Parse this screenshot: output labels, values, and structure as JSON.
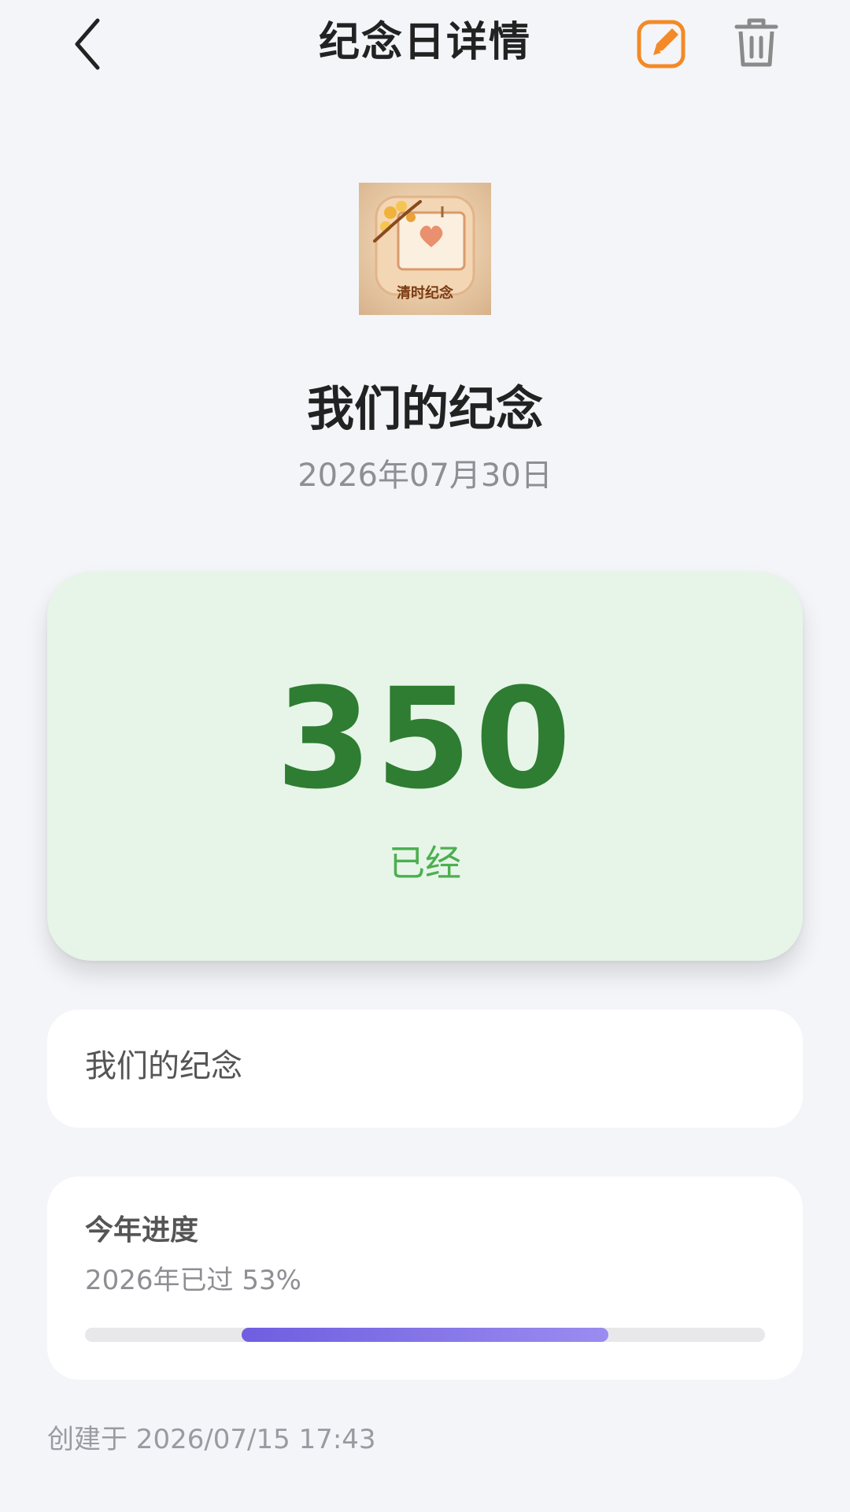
{
  "header": {
    "title": "纪念日详情",
    "back_icon": "chevron-left-icon",
    "edit_icon": "edit-icon",
    "delete_icon": "trash-icon",
    "accent_color": "#f38a26"
  },
  "event": {
    "image_caption": "清时纪念",
    "title": "我们的纪念",
    "date": "2026年07月30日"
  },
  "counter": {
    "days": "350",
    "status": "已经",
    "card_color": "#e7f5e8",
    "number_color": "#2e7d32",
    "status_color": "#4caf50"
  },
  "note": {
    "text": "我们的纪念"
  },
  "progress": {
    "title": "今年进度",
    "description": "2026年已过 53%",
    "fill_start": 0.23,
    "fill_end": 0.77,
    "colors": [
      "#6f5ee0",
      "#9a8cf0"
    ]
  },
  "footer": {
    "created": "创建于 2026/07/15 17:43"
  }
}
